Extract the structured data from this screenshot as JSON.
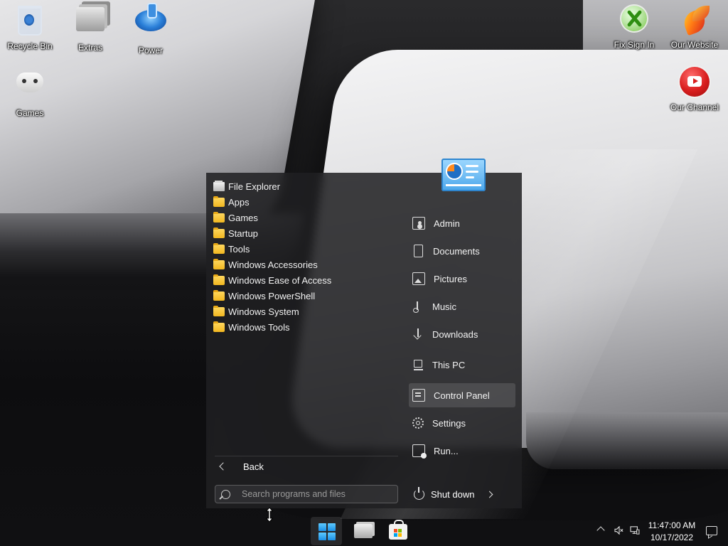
{
  "desktop": {
    "left_icons": [
      {
        "label": "Recycle Bin",
        "icon": "recycle-bin-icon"
      },
      {
        "label": "Extras",
        "icon": "folder-stack-icon"
      },
      {
        "label": "Power",
        "icon": "power-orb-icon"
      },
      {
        "label": "Games",
        "icon": "game-controller-icon"
      }
    ],
    "right_icons": [
      {
        "label": "Fix Sign In",
        "icon": "xbox-icon"
      },
      {
        "label": "Our Website",
        "icon": "phoenix-icon"
      },
      {
        "label": "Our Channel",
        "icon": "youtube-icon"
      }
    ]
  },
  "start_menu": {
    "programs": [
      {
        "label": "File Explorer",
        "icon": "file-explorer-icon"
      },
      {
        "label": "Apps",
        "icon": "folder-icon"
      },
      {
        "label": "Games",
        "icon": "folder-icon"
      },
      {
        "label": "Startup",
        "icon": "folder-icon"
      },
      {
        "label": "Tools",
        "icon": "folder-icon"
      },
      {
        "label": "Windows Accessories",
        "icon": "folder-icon"
      },
      {
        "label": "Windows Ease of Access",
        "icon": "folder-icon"
      },
      {
        "label": "Windows PowerShell",
        "icon": "folder-icon"
      },
      {
        "label": "Windows System",
        "icon": "folder-icon"
      },
      {
        "label": "Windows Tools",
        "icon": "folder-icon"
      }
    ],
    "back_label": "Back",
    "search_placeholder": "Search programs and files",
    "places": [
      {
        "label": "Admin",
        "icon": "user-folder-icon"
      },
      {
        "label": "Documents",
        "icon": "document-icon"
      },
      {
        "label": "Pictures",
        "icon": "picture-icon"
      },
      {
        "label": "Music",
        "icon": "music-icon"
      },
      {
        "label": "Downloads",
        "icon": "download-icon"
      },
      {
        "label": "This PC",
        "icon": "computer-icon"
      },
      {
        "label": "Control Panel",
        "icon": "control-panel-icon",
        "highlighted": true
      },
      {
        "label": "Settings",
        "icon": "gear-icon"
      },
      {
        "label": "Run...",
        "icon": "run-icon"
      }
    ],
    "shutdown_label": "Shut down"
  },
  "taskbar": {
    "buttons": [
      {
        "name": "start",
        "icon": "windows-logo-icon",
        "active": true
      },
      {
        "name": "file-explorer",
        "icon": "file-explorer-icon"
      },
      {
        "name": "store",
        "icon": "store-icon"
      }
    ],
    "clock": {
      "time": "11:47:00 AM",
      "date": "10/17/2022"
    }
  },
  "colors": {
    "accent": "#1a8fe6",
    "menu_bg": "#202022",
    "folder": "#f2b720"
  }
}
